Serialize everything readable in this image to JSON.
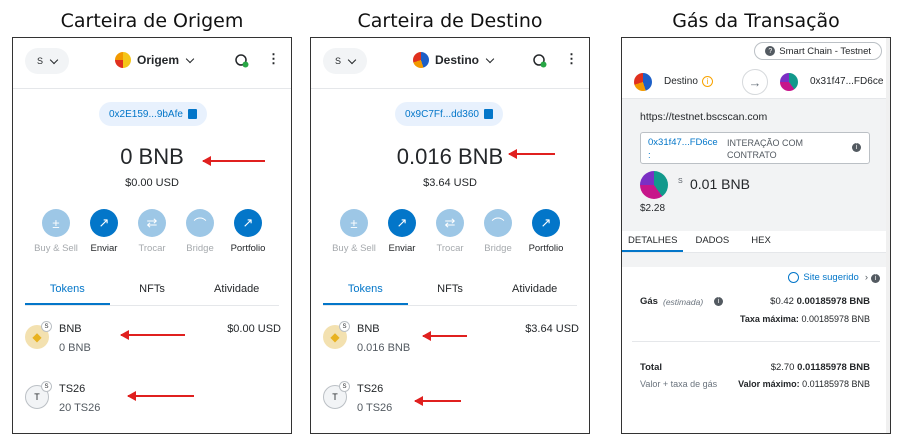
{
  "captions": {
    "origin": "Carteira de Origem",
    "dest": "Carteira de Destino",
    "gas": "Gás da Transação"
  },
  "origin": {
    "network_label": "S",
    "account": "Origem",
    "address": "0x2E159...9bAfe",
    "balance": "0 BNB",
    "balance_usd": "$0.00 USD",
    "actions": [
      {
        "label": "Buy & Sell",
        "icon": "buy-sell-icon",
        "disabled": true
      },
      {
        "label": "Enviar",
        "icon": "send-icon",
        "disabled": false
      },
      {
        "label": "Trocar",
        "icon": "swap-icon",
        "disabled": true
      },
      {
        "label": "Bridge",
        "icon": "bridge-icon",
        "disabled": true
      },
      {
        "label": "Portfolio",
        "icon": "portfolio-icon",
        "disabled": false
      }
    ],
    "tabs": [
      "Tokens",
      "NFTs",
      "Atividade"
    ],
    "assets": [
      {
        "name": "BNB",
        "amount": "0 BNB",
        "usd": "$0.00 USD",
        "badge": "S"
      },
      {
        "name": "TS26",
        "amount": "20 TS26",
        "usd": "",
        "badge": "S",
        "icon_letter": "T"
      }
    ]
  },
  "dest": {
    "network_label": "S",
    "account": "Destino",
    "address": "0x9C7Ff...dd360",
    "balance": "0.016 BNB",
    "balance_usd": "$3.64 USD",
    "actions": [
      {
        "label": "Buy & Sell",
        "icon": "buy-sell-icon",
        "disabled": true
      },
      {
        "label": "Enviar",
        "icon": "send-icon",
        "disabled": false
      },
      {
        "label": "Trocar",
        "icon": "swap-icon",
        "disabled": true
      },
      {
        "label": "Bridge",
        "icon": "bridge-icon",
        "disabled": true
      },
      {
        "label": "Portfolio",
        "icon": "portfolio-icon",
        "disabled": false
      }
    ],
    "tabs": [
      "Tokens",
      "NFTs",
      "Atividade"
    ],
    "assets": [
      {
        "name": "BNB",
        "amount": "0.016 BNB",
        "usd": "$3.64 USD",
        "badge": "S"
      },
      {
        "name": "TS26",
        "amount": "0 TS26",
        "usd": "",
        "badge": "S",
        "icon_letter": "T"
      }
    ]
  },
  "tx": {
    "network": "Smart Chain - Testnet",
    "from": "Destino",
    "to": "0x31f47...FD6ce",
    "site": "https://testnet.bscscan.com",
    "contract_addr": "0x31f47...FD6ce",
    "contract_colon": ":",
    "contract_type": "INTERAÇÃO COM CONTRATO",
    "amount_badge": "S",
    "amount": "0.01 BNB",
    "amount_usd": "$2.28",
    "tabs": [
      "DETALHES",
      "DADOS",
      "HEX"
    ],
    "suggested": "Site sugerido",
    "gas_label": "Gás",
    "gas_estimated": "(estimada)",
    "gas_usd": "$0.42",
    "gas_bnb": "0.00185978 BNB",
    "max_fee_label": "Taxa máxima:",
    "max_fee": "0.00185978 BNB",
    "total_label": "Total",
    "total_usd": "$2.70",
    "total_bnb": "0.01185978 BNB",
    "total_sub": "Valor + taxa de gás",
    "max_value_label": "Valor máximo:",
    "max_value": "0.01185978 BNB"
  },
  "colors": {
    "accent": "#0376c9",
    "arrow": "#e0201f"
  }
}
